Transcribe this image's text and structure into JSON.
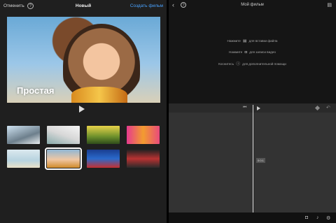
{
  "left": {
    "cancel_label": "Отменить",
    "help_icon": "question-circle-icon",
    "title": "Новый",
    "create_label": "Создать фильм",
    "preview": {
      "label": "Простая",
      "play_icon": "play-icon"
    },
    "themes": [
      {
        "caption": "",
        "selected": false
      },
      {
        "caption": "",
        "selected": false
      },
      {
        "caption": "",
        "selected": false
      },
      {
        "caption": "",
        "selected": false
      },
      {
        "caption": "",
        "selected": false
      },
      {
        "caption": "",
        "selected": true
      },
      {
        "caption": "",
        "selected": false
      },
      {
        "caption": "",
        "selected": false
      }
    ]
  },
  "right": {
    "back_icon": "chevron-left-icon",
    "help_icon": "question-circle-icon",
    "title": "Мой фильм",
    "insert_icon": "insert-media-icon",
    "hint_line1_a": "Нажмите",
    "hint_line1_b": "для вставки файла",
    "hint_line2_a": "Нажмите",
    "hint_line2_b": "для записи видео",
    "hint_line3_a": "Коснитесь",
    "hint_line3_b": "для дополнительной помощи",
    "timeline_badge": "0:0:1",
    "footer_icons": [
      "camera-icon",
      "microphone-icon",
      "gear-icon"
    ]
  },
  "colors": {
    "accent": "#4aa3ff",
    "background": "#1f1f1f"
  }
}
